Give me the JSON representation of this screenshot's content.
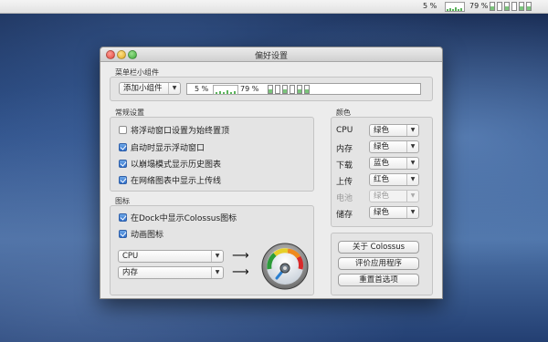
{
  "menubar": {
    "cpu": "5 %",
    "memory": "79 %",
    "cells_on": [
      1,
      0,
      1,
      0,
      1,
      1
    ]
  },
  "window": {
    "title": "偏好设置"
  },
  "widget_section": {
    "label": "菜单栏小组件",
    "add_widget": "添加小组件",
    "preview_cpu": "5 %",
    "preview_memory": "79 %"
  },
  "general": {
    "label": "常规设置",
    "options": [
      {
        "label": "将浮动窗口设置为始终置顶",
        "checked": false
      },
      {
        "label": "启动时显示浮动窗口",
        "checked": true
      },
      {
        "label": "以崩塌模式显示历史图表",
        "checked": true
      },
      {
        "label": "在网络图表中显示上传线",
        "checked": true
      }
    ]
  },
  "icon_section": {
    "label": "图标",
    "options": [
      {
        "label": "在Dock中显示Colossus图标",
        "checked": true
      },
      {
        "label": "动画图标",
        "checked": true
      }
    ],
    "select1": "CPU",
    "select2": "内存",
    "arrow": "⟶"
  },
  "colors": {
    "label": "颜色",
    "rows": [
      {
        "name": "CPU",
        "value": "绿色",
        "enabled": true
      },
      {
        "name": "内存",
        "value": "绿色",
        "enabled": true
      },
      {
        "name": "下载",
        "value": "蓝色",
        "enabled": true
      },
      {
        "name": "上传",
        "value": "红色",
        "enabled": true
      },
      {
        "name": "电池",
        "value": "绿色",
        "enabled": false
      },
      {
        "name": "储存",
        "value": "绿色",
        "enabled": true
      }
    ]
  },
  "buttons": {
    "about": "关于 Colossus",
    "rate": "评价应用程序",
    "reset": "重置首选项"
  },
  "icons": {
    "dropdown": "chevron-down-icon",
    "close": "close-icon",
    "minimize": "minimize-icon",
    "maximize": "zoom-icon",
    "gauge": "gauge-icon",
    "arrow": "arrow-right-icon"
  }
}
